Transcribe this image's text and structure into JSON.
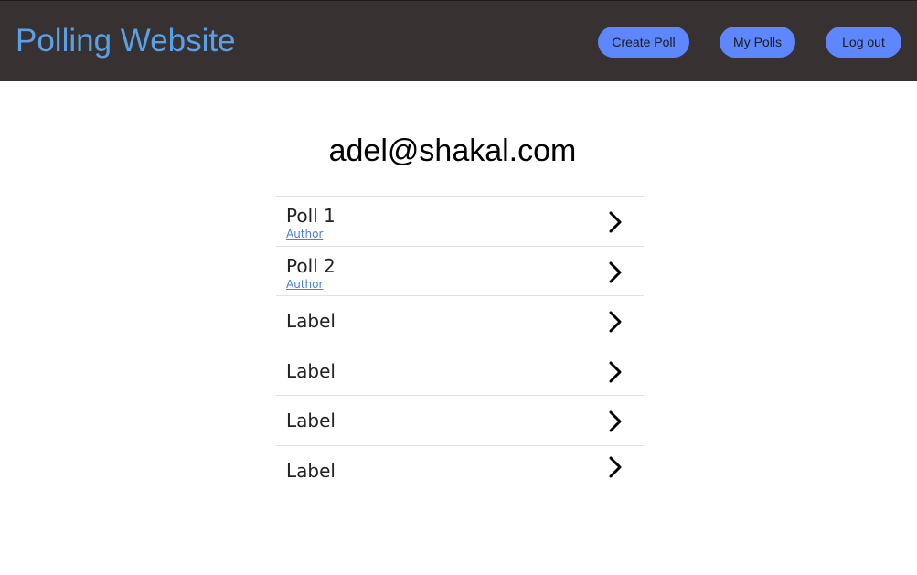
{
  "header": {
    "title": "Polling Website",
    "buttons": {
      "create_poll": "Create Poll",
      "my_polls": "My Polls",
      "log_out": "Log out"
    },
    "colors": {
      "background": "#383131",
      "title": "#5aa0e6",
      "button": "#5d86ff"
    }
  },
  "main": {
    "user_email": "adel@shakal.com",
    "polls": [
      {
        "title": "Poll 1",
        "author_link": "Author",
        "icon": "chevron-right-icon"
      },
      {
        "title": "Poll 2",
        "author_link": "Author",
        "icon": "chevron-right-icon"
      },
      {
        "title": "Label",
        "icon": "chevron-right-icon"
      },
      {
        "title": "Label",
        "icon": "chevron-right-icon"
      },
      {
        "title": "Label",
        "icon": "chevron-right-icon"
      },
      {
        "title": "Label",
        "icon": "chevron-right-icon"
      }
    ]
  }
}
